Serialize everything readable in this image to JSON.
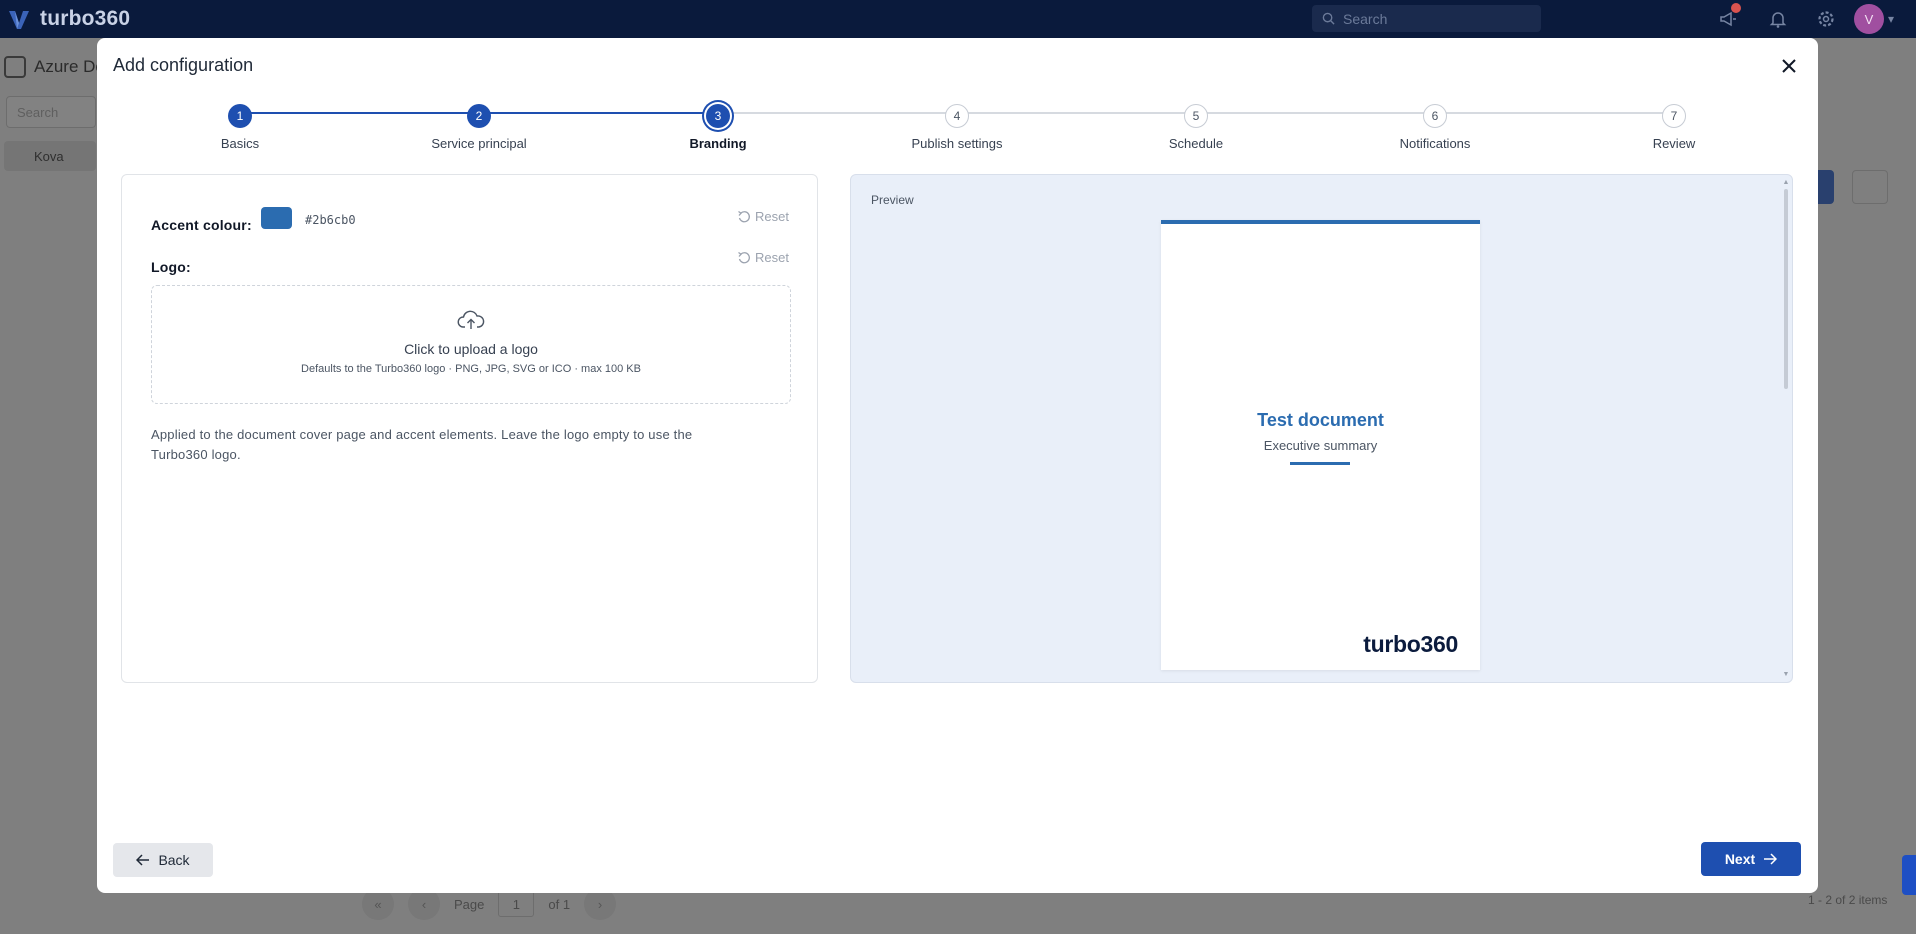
{
  "app": {
    "brand": "turbo360",
    "search_placeholder": "Search",
    "avatar_initial": "V",
    "background_title": "Azure Do",
    "background_search": "Search",
    "background_folder": "Kova",
    "pager": {
      "page_label": "Page",
      "page_value": "1",
      "of_label": "of 1",
      "items_label": "1 - 2 of 2 items"
    }
  },
  "modal": {
    "title": "Add configuration",
    "steps": [
      {
        "number": "1",
        "label": "Basics",
        "state": "done"
      },
      {
        "number": "2",
        "label": "Service principal",
        "state": "done"
      },
      {
        "number": "3",
        "label": "Branding",
        "state": "current"
      },
      {
        "number": "4",
        "label": "Publish settings",
        "state": "todo"
      },
      {
        "number": "5",
        "label": "Schedule",
        "state": "todo"
      },
      {
        "number": "6",
        "label": "Notifications",
        "state": "todo"
      },
      {
        "number": "7",
        "label": "Review",
        "state": "todo"
      }
    ],
    "branding": {
      "accent_label": "Accent colour:",
      "accent_value": "#2b6cb0",
      "reset_label": "Reset",
      "logo_label": "Logo:",
      "upload_title": "Click to upload a logo",
      "upload_hint": "Defaults to the Turbo360 logo · PNG, JPG, SVG or ICO · max 100 KB",
      "help_text": "Applied to the document cover page and accent elements. Leave the logo empty to use the Turbo360 logo."
    },
    "preview": {
      "label": "Preview",
      "doc_title": "Test document",
      "doc_subtitle": "Executive summary",
      "doc_logo": "turbo360"
    },
    "back_label": "Back",
    "next_label": "Next"
  },
  "colors": {
    "primary": "#1e4fb0",
    "accent": "#2b6cb0",
    "navbar": "#0a1a3c",
    "preview_bg": "#e9eff9"
  },
  "icons": {
    "close": "close-icon",
    "reset": "undo-icon",
    "upload": "cloud-upload-icon",
    "back": "arrow-left-icon",
    "next": "arrow-right-icon"
  }
}
